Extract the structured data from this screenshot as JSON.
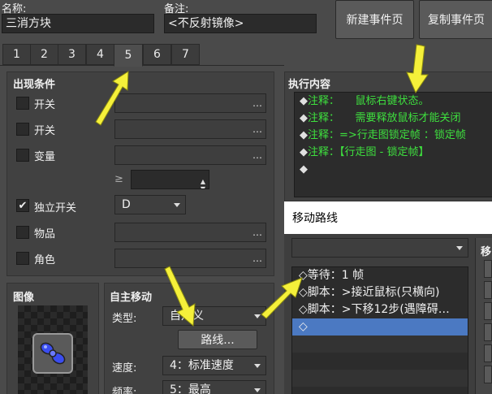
{
  "header": {
    "name_label": "名称:",
    "name_value": "三消方块",
    "note_label": "备注:",
    "note_value": "<不反射镜像>",
    "new_page_button": "新建事件页",
    "copy_page_button": "复制事件页"
  },
  "tabs": [
    "1",
    "2",
    "3",
    "4",
    "5",
    "6",
    "7"
  ],
  "active_tab": "5",
  "conditions": {
    "title": "出现条件",
    "switch1_label": "开关",
    "switch2_label": "开关",
    "variable_label": "变量",
    "ge_symbol": "≥",
    "self_switch_label": "独立开关",
    "self_switch_checked": true,
    "self_switch_value": "D",
    "item_label": "物品",
    "actor_label": "角色",
    "dots": "…"
  },
  "image": {
    "title": "图像",
    "icon": "blue-bow-sprite-icon"
  },
  "autonomous": {
    "title": "自主移动",
    "type_label": "类型:",
    "type_value": "自定义",
    "route_button": "路线...",
    "speed_label": "速度:",
    "speed_value": "4：标准速度",
    "freq_label": "频率:",
    "freq_value": "5：最高"
  },
  "execution": {
    "title": "执行内容",
    "lines": [
      {
        "prefix": "◆",
        "text": "注释：　　鼠标右键状态。",
        "green": true
      },
      {
        "prefix": "◆",
        "text": "注释：　　需要释放鼠标才能关闭",
        "green": true
      },
      {
        "prefix": "◆",
        "text": "注释：=>行走图锁定帧 ：锁定帧",
        "green": true
      },
      {
        "prefix": "◆",
        "text": "注释：【行走图 - 锁定帧】",
        "green": true
      },
      {
        "prefix": "◆",
        "text": "",
        "green": false
      }
    ]
  },
  "move_route": {
    "title": "移动路线",
    "target_value": "",
    "right_header": "移",
    "rows": [
      {
        "text": "◇等待：1 帧",
        "selected": false
      },
      {
        "text": "◇脚本：>接近鼠标(只横向)",
        "selected": false
      },
      {
        "text": "◇脚本：>下移12步(遇障碍…",
        "selected": false
      },
      {
        "text": "◇",
        "selected": true
      }
    ]
  },
  "colors": {
    "accent_selected": "#4b79c2",
    "comment_green": "#3ee03e",
    "arrow_yellow": "#f5f03a"
  }
}
